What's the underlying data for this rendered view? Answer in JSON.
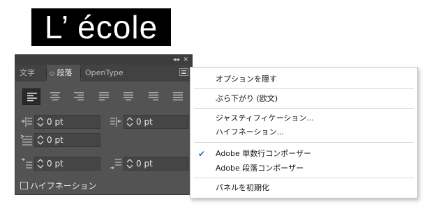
{
  "sample_text": "L’ école",
  "panel": {
    "collapse_glyph": "◂◂",
    "close_glyph": "✕",
    "tabs": [
      {
        "label": "文字",
        "active": false
      },
      {
        "label": "段落",
        "active": true,
        "prefix": "◇"
      },
      {
        "label": "OpenType",
        "active": false
      }
    ],
    "alignment": {
      "buttons": [
        "align-left",
        "align-center",
        "align-right",
        "justify-last-left",
        "justify-last-center",
        "justify-last-right",
        "justify-all"
      ],
      "selected": "align-left"
    },
    "fields": {
      "left_indent": "0 pt",
      "right_indent": "0 pt",
      "first_line_indent": "0 pt",
      "space_before": "0 pt",
      "space_after": "0 pt"
    },
    "hyphenation_label": "ハイフネーション",
    "hyphenation_checked": false
  },
  "flyout": {
    "items": [
      {
        "label": "オプションを隠す"
      },
      {
        "label": "ぶら下がり (欧文)"
      },
      {
        "label": "ジャスティフィケーション..."
      },
      {
        "label": "ハイフネーション..."
      },
      {
        "label": "Adobe 単数行コンポーザー",
        "checked": true
      },
      {
        "label": "Adobe 段落コンポーザー"
      },
      {
        "label": "パネルを初期化"
      }
    ],
    "check_glyph": "✔"
  },
  "colors": {
    "panel_bg": "#535353",
    "tab_bar_bg": "#424242",
    "field_bg": "#454545",
    "check_accent": "#1f6fd1"
  }
}
